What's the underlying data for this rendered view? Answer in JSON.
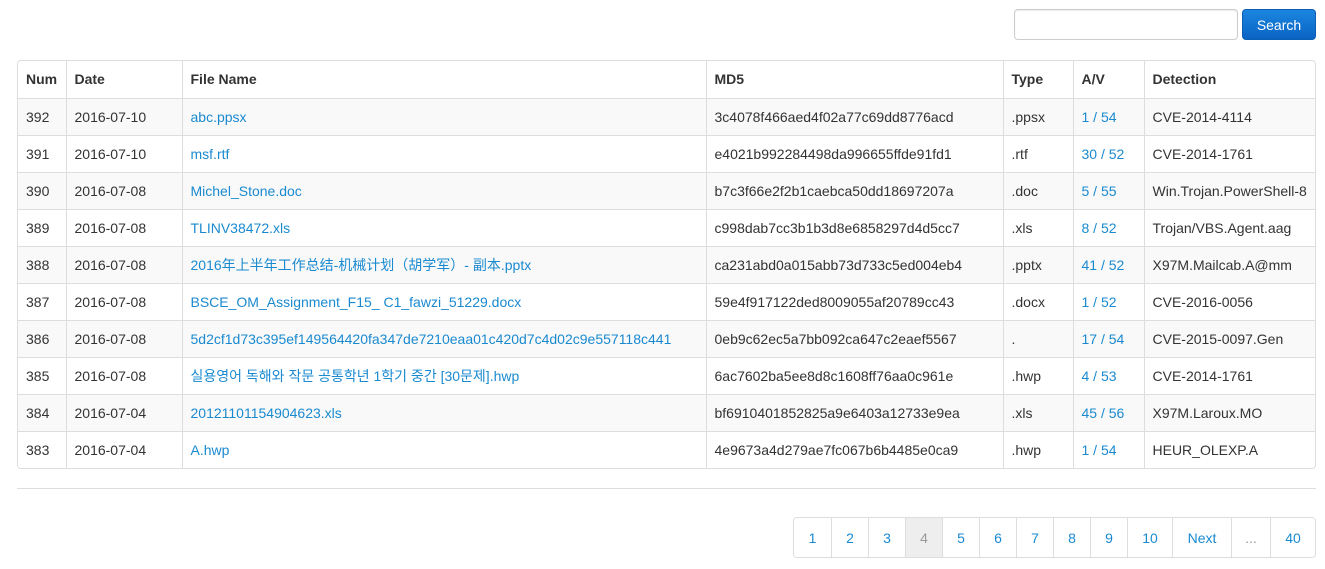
{
  "search": {
    "value": "",
    "placeholder": "",
    "button_label": "Search"
  },
  "table": {
    "headers": {
      "num": "Num",
      "date": "Date",
      "file_name": "File Name",
      "md5": "MD5",
      "type": "Type",
      "av": "A/V",
      "detection": "Detection"
    },
    "rows": [
      {
        "num": "392",
        "date": "2016-07-10",
        "file_name": "abc.ppsx",
        "md5": "3c4078f466aed4f02a77c69dd8776acd",
        "type": ".ppsx",
        "av": "1 / 54",
        "detection": "CVE-2014-4114"
      },
      {
        "num": "391",
        "date": "2016-07-10",
        "file_name": "msf.rtf",
        "md5": "e4021b992284498da996655ffde91fd1",
        "type": ".rtf",
        "av": "30 / 52",
        "detection": "CVE-2014-1761"
      },
      {
        "num": "390",
        "date": "2016-07-08",
        "file_name": "Michel_Stone.doc",
        "md5": "b7c3f66e2f2b1caebca50dd18697207a",
        "type": ".doc",
        "av": "5 / 55",
        "detection": "Win.Trojan.PowerShell-8"
      },
      {
        "num": "389",
        "date": "2016-07-08",
        "file_name": "TLINV38472.xls",
        "md5": "c998dab7cc3b1b3d8e6858297d4d5cc7",
        "type": ".xls",
        "av": "8 / 52",
        "detection": "Trojan/VBS.Agent.aag"
      },
      {
        "num": "388",
        "date": "2016-07-08",
        "file_name": "2016年上半年工作总结-机械计划（胡学军）- 副本.pptx",
        "md5": "ca231abd0a015abb73d733c5ed004eb4",
        "type": ".pptx",
        "av": "41 / 52",
        "detection": "X97M.Mailcab.A@mm"
      },
      {
        "num": "387",
        "date": "2016-07-08",
        "file_name": "BSCE_OM_Assignment_F15_ C1_fawzi_51229.docx",
        "md5": "59e4f917122ded8009055af20789cc43",
        "type": ".docx",
        "av": "1 / 52",
        "detection": "CVE-2016-0056"
      },
      {
        "num": "386",
        "date": "2016-07-08",
        "file_name": "5d2cf1d73c395ef149564420fa347de7210eaa01c420d7c4d02c9e557118c441",
        "md5": "0eb9c62ec5a7bb092ca647c2eaef5567",
        "type": ".",
        "av": "17 / 54",
        "detection": "CVE-2015-0097.Gen"
      },
      {
        "num": "385",
        "date": "2016-07-08",
        "file_name": "실용영어 독해와 작문 공통학년 1학기 중간 [30문제].hwp",
        "md5": "6ac7602ba5ee8d8c1608ff76aa0c961e",
        "type": ".hwp",
        "av": "4 / 53",
        "detection": "CVE-2014-1761"
      },
      {
        "num": "384",
        "date": "2016-07-04",
        "file_name": "20121101154904623.xls",
        "md5": "bf6910401852825a9e6403a12733e9ea",
        "type": ".xls",
        "av": "45 / 56",
        "detection": "X97M.Laroux.MO"
      },
      {
        "num": "383",
        "date": "2016-07-04",
        "file_name": "A.hwp",
        "md5": "4e9673a4d279ae7fc067b6b4485e0ca9",
        "type": ".hwp",
        "av": "1 / 54",
        "detection": "HEUR_OLEXP.A"
      }
    ]
  },
  "pagination": {
    "items": [
      {
        "label": "1",
        "state": "normal"
      },
      {
        "label": "2",
        "state": "normal"
      },
      {
        "label": "3",
        "state": "normal"
      },
      {
        "label": "4",
        "state": "active"
      },
      {
        "label": "5",
        "state": "normal"
      },
      {
        "label": "6",
        "state": "normal"
      },
      {
        "label": "7",
        "state": "normal"
      },
      {
        "label": "8",
        "state": "normal"
      },
      {
        "label": "9",
        "state": "normal"
      },
      {
        "label": "10",
        "state": "normal"
      },
      {
        "label": "Next",
        "state": "normal"
      },
      {
        "label": "...",
        "state": "disabled"
      },
      {
        "label": "40",
        "state": "normal"
      }
    ]
  },
  "colors": {
    "link": "#1a8ad0",
    "button": "#0a63c4",
    "border": "#dddddd",
    "stripe": "#f9f9f9",
    "active_page": "#eeeeee"
  }
}
